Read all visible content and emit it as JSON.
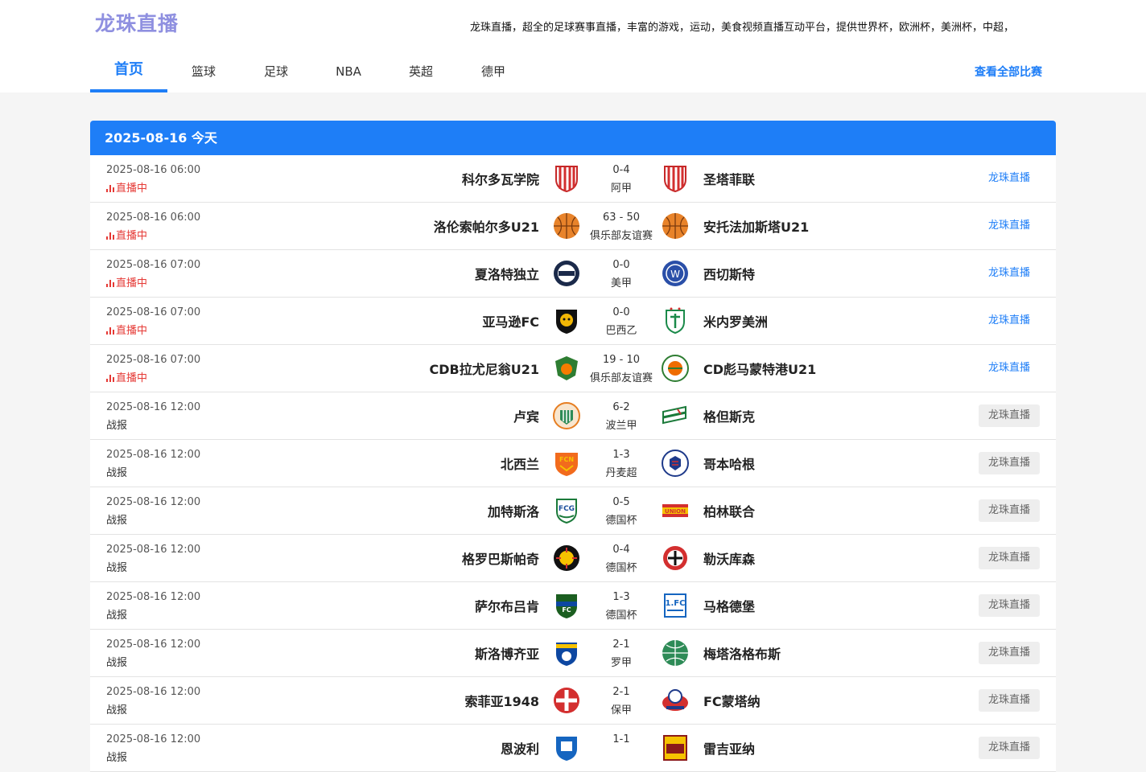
{
  "site": {
    "logo": "龙珠直播",
    "slogan": "龙珠直播，超全的足球赛事直播，丰富的游戏，运动，美食视频直播互动平台，提供世界杯，欧洲杯，美洲杯，中超，"
  },
  "nav": {
    "items": [
      "首页",
      "篮球",
      "足球",
      "NBA",
      "英超",
      "德甲"
    ],
    "view_all": "查看全部比赛"
  },
  "panel": {
    "title": "2025-08-16  今天"
  },
  "colors": {
    "accent": "#1e7ef7",
    "live": "#e53935"
  },
  "matches": [
    {
      "time": "2025-08-16 06:00",
      "status": "直播中",
      "live": true,
      "home": "科尔多瓦学院",
      "home_icon": "red-white-striped-shield-icon",
      "score": "0-4",
      "league": "阿甲",
      "away": "圣塔菲联",
      "away_icon": "red-white-striped-shield-icon",
      "action": "龙珠直播"
    },
    {
      "time": "2025-08-16 06:00",
      "status": "直播中",
      "live": true,
      "home": "洛伦索帕尔多U21",
      "home_icon": "basketball-icon",
      "score": "63 - 50",
      "league": "俱乐部友谊赛",
      "away": "安托法加斯塔U21",
      "away_icon": "basketball-icon",
      "action": "龙珠直播"
    },
    {
      "time": "2025-08-16 07:00",
      "status": "直播中",
      "live": true,
      "home": "夏洛特独立",
      "home_icon": "navy-crest-icon",
      "score": "0-0",
      "league": "美甲",
      "away": "西切斯特",
      "away_icon": "blue-round-crest-icon",
      "action": "龙珠直播"
    },
    {
      "time": "2025-08-16 07:00",
      "status": "直播中",
      "live": true,
      "home": "亚马逊FC",
      "home_icon": "jaguar-crest-icon",
      "score": "0-0",
      "league": "巴西乙",
      "away": "米内罗美洲",
      "away_icon": "green-shield-icon",
      "action": "龙珠直播"
    },
    {
      "time": "2025-08-16 07:00",
      "status": "直播中",
      "live": true,
      "home": "CDB拉尤尼翁U21",
      "home_icon": "green-orange-crest-icon",
      "score": "19 - 10",
      "league": "俱乐部友谊赛",
      "away": "CD彪马蒙特港U21",
      "away_icon": "orange-green-ball-icon",
      "action": "龙珠直播"
    },
    {
      "time": "2025-08-16 12:00",
      "status": "战报",
      "live": false,
      "home": "卢宾",
      "home_icon": "orange-green-crest-icon",
      "score": "6-2",
      "league": "波兰甲",
      "away": "格但斯克",
      "away_icon": "green-flag-crest-icon",
      "action": "龙珠直播"
    },
    {
      "time": "2025-08-16 12:00",
      "status": "战报",
      "live": false,
      "home": "北西兰",
      "home_icon": "orange-lion-crest-icon",
      "score": "1-3",
      "league": "丹麦超",
      "away": "哥本哈根",
      "away_icon": "lion-crest-icon",
      "action": "龙珠直播"
    },
    {
      "time": "2025-08-16 12:00",
      "status": "战报",
      "live": false,
      "home": "加特斯洛",
      "home_icon": "green-shield-fcg-icon",
      "score": "0-5",
      "league": "德国杯",
      "away": "柏林联合",
      "away_icon": "red-yellow-union-icon",
      "action": "龙珠直播"
    },
    {
      "time": "2025-08-16 12:00",
      "status": "战报",
      "live": false,
      "home": "格罗巴斯帕奇",
      "home_icon": "black-sun-crest-icon",
      "score": "0-4",
      "league": "德国杯",
      "away": "勒沃库森",
      "away_icon": "bayer-cross-icon",
      "action": "龙珠直播"
    },
    {
      "time": "2025-08-16 12:00",
      "status": "战报",
      "live": false,
      "home": "萨尔布吕肯",
      "home_icon": "saarbrucken-crest-icon",
      "score": "1-3",
      "league": "德国杯",
      "away": "马格德堡",
      "away_icon": "magdeburg-crest-icon",
      "action": "龙珠直播"
    },
    {
      "time": "2025-08-16 12:00",
      "status": "战报",
      "live": false,
      "home": "斯洛博齐亚",
      "home_icon": "slobozia-crest-icon",
      "score": "2-1",
      "league": "罗甲",
      "away": "梅塔洛格布斯",
      "away_icon": "green-globe-crest-icon",
      "action": "龙珠直播"
    },
    {
      "time": "2025-08-16 12:00",
      "status": "战报",
      "live": false,
      "home": "索菲亚1948",
      "home_icon": "red-cross-crest-icon",
      "score": "2-1",
      "league": "保甲",
      "away": "FC蒙塔纳",
      "away_icon": "red-ball-crest-icon",
      "action": "龙珠直播"
    },
    {
      "time": "2025-08-16 12:00",
      "status": "战报",
      "live": false,
      "home": "恩波利",
      "home_icon": "blue-shield-crest-icon",
      "score": "1-1",
      "league": "",
      "away": "雷吉亚纳",
      "away_icon": "calcio-crest-icon",
      "action": "龙珠直播"
    }
  ]
}
